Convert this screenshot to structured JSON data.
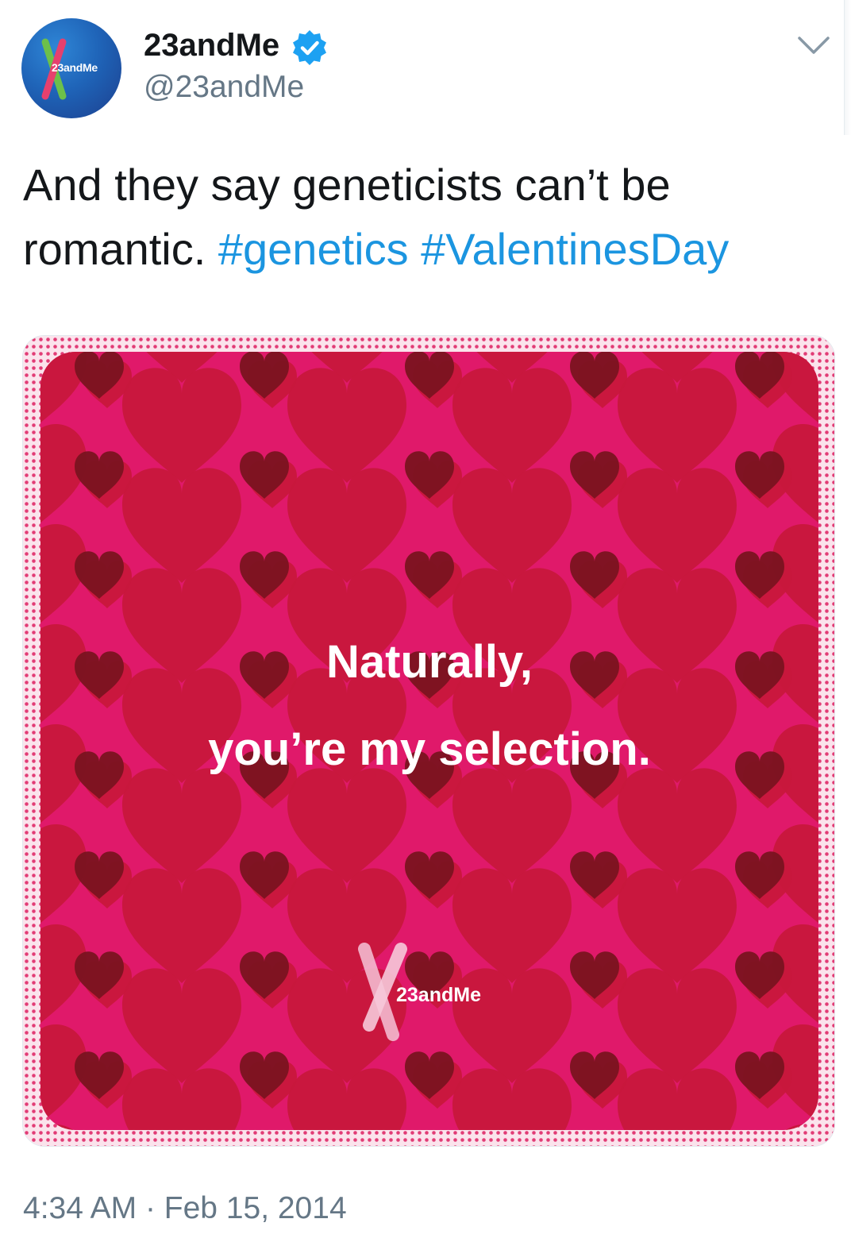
{
  "tweet": {
    "display_name": "23andMe",
    "handle": "@23andMe",
    "avatar_label": "23andMe",
    "text_plain": "And they say geneticists can’t be romantic.",
    "hashtags": [
      "#genetics",
      "#ValentinesDay"
    ],
    "time": "4:34 AM",
    "separator": "·",
    "date": "Feb 15, 2014"
  },
  "media": {
    "headline_line1": "Naturally,",
    "headline_line2": "you’re my selection.",
    "logo_text": "23andMe"
  },
  "icons": {
    "avatar": "23andme-logo",
    "verified": "verified-badge-icon",
    "menu": "chevron-down-icon"
  },
  "colors": {
    "link": "#1b95e0",
    "verified": "#1da1f2",
    "card_background": "#e0196a",
    "heart_dark": "#7a1320",
    "heart_red": "#c8173c",
    "secondary_text": "#657786"
  }
}
